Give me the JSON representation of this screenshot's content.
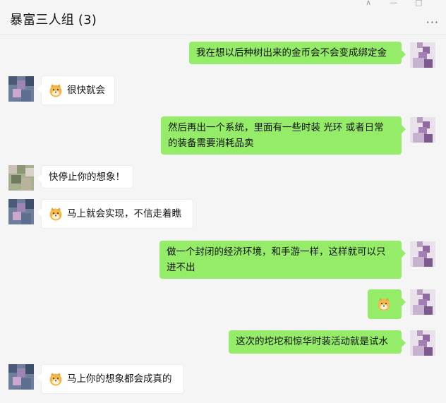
{
  "window": {
    "title": "暴富三人组 (3)",
    "pin_glyph": "⊼",
    "minimize_glyph": "—",
    "maximize_glyph": "□",
    "more_glyph": "···"
  },
  "messages": [
    {
      "side": "right",
      "text": "我在想以后种树出来的金币会不会变成绑定金"
    },
    {
      "side": "left",
      "emoji": "doge-emoji",
      "text": "很快就会"
    },
    {
      "side": "right",
      "line1": "然后再出一个系统，里面有一些时装 光环  或者日常",
      "line2": "的装备需要消耗品卖"
    },
    {
      "side": "left",
      "text": "快停止你的想象！"
    },
    {
      "side": "left",
      "emoji": "doge-emoji",
      "text": "马上就会实现，不信走着瞧"
    },
    {
      "side": "right",
      "line1": "做一个封闭的经济环境，和手游一样，这样就可以只",
      "line2": "进不出"
    },
    {
      "side": "right",
      "emoji": "doge-emoji",
      "text": ""
    },
    {
      "side": "right",
      "text": "这次的坨坨和惊华时装活动就是试水"
    },
    {
      "side": "left",
      "emoji": "doge-emoji",
      "text": "马上你的想象都会成真的"
    }
  ],
  "colors": {
    "background": "#f5f5f5",
    "self_bubble": "#95ec69",
    "other_bubble": "#ffffff"
  }
}
